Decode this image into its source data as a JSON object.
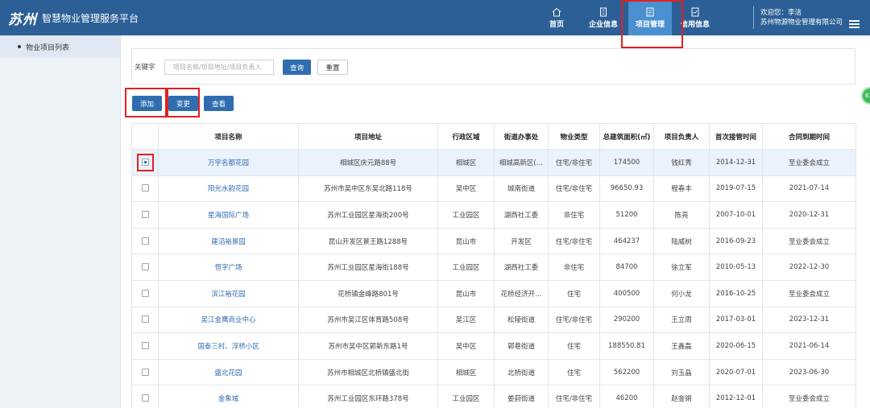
{
  "app": {
    "logo_mark": "苏州",
    "title": "智慧物业管理服务平台"
  },
  "nav": [
    {
      "label": "首页",
      "icon": "home-icon"
    },
    {
      "label": "企业信息",
      "icon": "building-icon"
    },
    {
      "label": "项目管理",
      "icon": "project-icon",
      "active": true
    },
    {
      "label": "信用信息",
      "icon": "credit-icon"
    }
  ],
  "user": {
    "greeting": "欢迎您：李洁",
    "company": "苏州物源物业管理有限公司"
  },
  "sidebar": {
    "items": [
      {
        "label": "物业项目列表"
      }
    ]
  },
  "search": {
    "label": "关键字",
    "placeholder": "项目名称/项目地址/项目负责人",
    "query_label": "查询",
    "reset_label": "重置"
  },
  "actions": {
    "add_label": "添加",
    "change_label": "变更",
    "view_label": "查看"
  },
  "table": {
    "columns": [
      "项目名称",
      "项目地址",
      "行政区域",
      "街道办事处",
      "物业类型",
      "总建筑面积(㎡)",
      "项目负责人",
      "首次接管时间",
      "合同到期时间"
    ],
    "rows": [
      [
        "万宇名都花园",
        "相城区庆元路88号",
        "相城区",
        "相城高新区(…",
        "住宅/非住宅",
        "174500",
        "钱红秀",
        "2014-12-31",
        "至业委会成立"
      ],
      [
        "阳光水韵花园",
        "苏州市吴中区东吴北路118号",
        "吴中区",
        "城南街道",
        "住宅/非住宅",
        "96650.93",
        "程春丰",
        "2019-07-15",
        "2021-07-14"
      ],
      [
        "星海国际广场",
        "苏州工业园区星海街200号",
        "工业园区",
        "湖西社工委",
        "非住宅",
        "51200",
        "陈亮",
        "2007-10-01",
        "2020-12-31"
      ],
      [
        "建滔裕景园",
        "昆山开发区景王路1288号",
        "昆山市",
        "开发区",
        "住宅/非住宅",
        "464237",
        "陆威树",
        "2016-09-23",
        "至业委会成立"
      ],
      [
        "恒宇广场",
        "苏州工业园区星海街188号",
        "工业园区",
        "湖西社工委",
        "非住宅",
        "84700",
        "徐立军",
        "2010-05-13",
        "2022-12-30"
      ],
      [
        "滨江裕花园",
        "花桥镇金峰路801号",
        "昆山市",
        "花桥经济开…",
        "住宅",
        "400500",
        "何小龙",
        "2016-10-25",
        "至业委会成立"
      ],
      [
        "吴江金鹰商业中心",
        "苏州市吴江区体育路508号",
        "吴江区",
        "松陵街道",
        "住宅/非住宅",
        "290200",
        "王立周",
        "2017-03-01",
        "2023-12-31"
      ],
      [
        "国泰三村、浮桥小区",
        "苏州市吴中区郭新东路1号",
        "吴中区",
        "郭巷街道",
        "住宅",
        "188550.81",
        "王鑫磊",
        "2020-06-15",
        "2021-06-14"
      ],
      [
        "盛北花园",
        "苏州市相城区北桥镇盛北街",
        "相城区",
        "北桥街道",
        "住宅",
        "562200",
        "刘玉晶",
        "2020-07-01",
        "2023-06-30"
      ],
      [
        "金象域",
        "苏州工业园区东环路378号",
        "工业园区",
        "娄葑街道",
        "住宅/非住宅",
        "46200",
        "赵金锵",
        "2012-12-01",
        "至业委会成立"
      ]
    ],
    "selected_row": 0
  },
  "badge": {
    "text": "63"
  },
  "colors": {
    "header": "#2c5f96",
    "primary": "#2f6db0",
    "highlight": "#e02020"
  }
}
